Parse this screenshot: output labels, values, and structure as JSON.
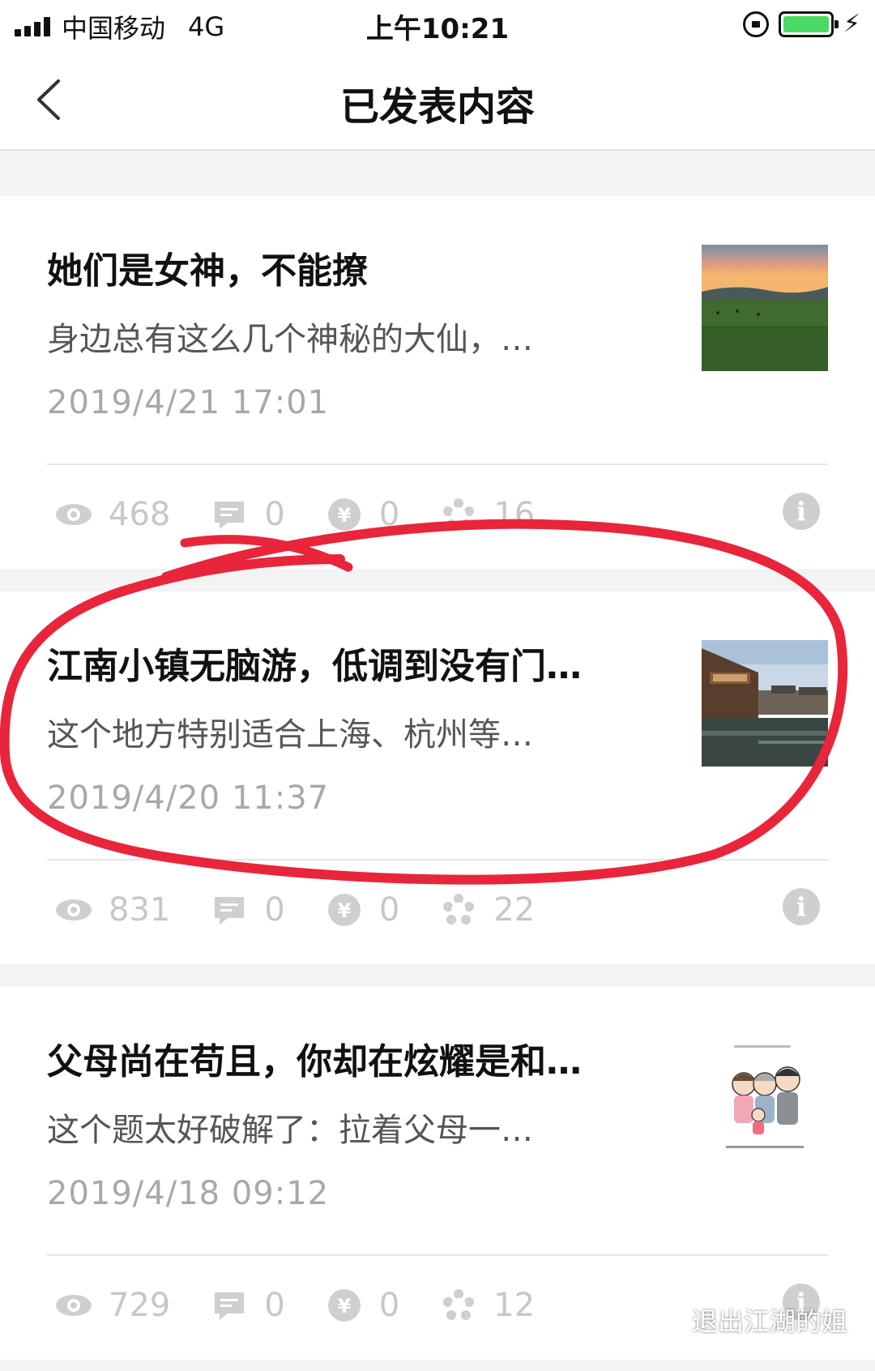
{
  "status_bar": {
    "carrier": "中国移动",
    "network": "4G",
    "time": "上午10:21",
    "battery_color": "#4cd964"
  },
  "nav": {
    "back_icon": "chevron-left-icon",
    "title": "已发表内容"
  },
  "articles": [
    {
      "title": "她们是女神，不能撩",
      "summary": "身边总有这么几个神秘的大仙，…",
      "date": "2019/4/21  17:01",
      "thumbnail": "sunset-grassland",
      "views": "468",
      "comments": "0",
      "rewards": "0",
      "shares": "16"
    },
    {
      "title": "江南小镇无脑游，低调到没有门…",
      "summary": "这个地方特别适合上海、杭州等…",
      "date": "2019/4/20  11:37",
      "thumbnail": "water-town",
      "views": "831",
      "comments": "0",
      "rewards": "0",
      "shares": "22",
      "highlighted": true
    },
    {
      "title": "父母尚在苟且，你却在炫耀是和…",
      "summary": "这个题太好破解了：拉着父母一…",
      "date": "2019/4/18  09:12",
      "thumbnail": "family-cartoon",
      "views": "729",
      "comments": "0",
      "rewards": "0",
      "shares": "12"
    }
  ],
  "icons": {
    "views": "eye-icon",
    "comments": "comment-icon",
    "rewards": "yen-icon",
    "shares": "share-icon",
    "info": "info-icon"
  },
  "highlight_color": "#e8253a",
  "watermark": "退出江湖的姐"
}
